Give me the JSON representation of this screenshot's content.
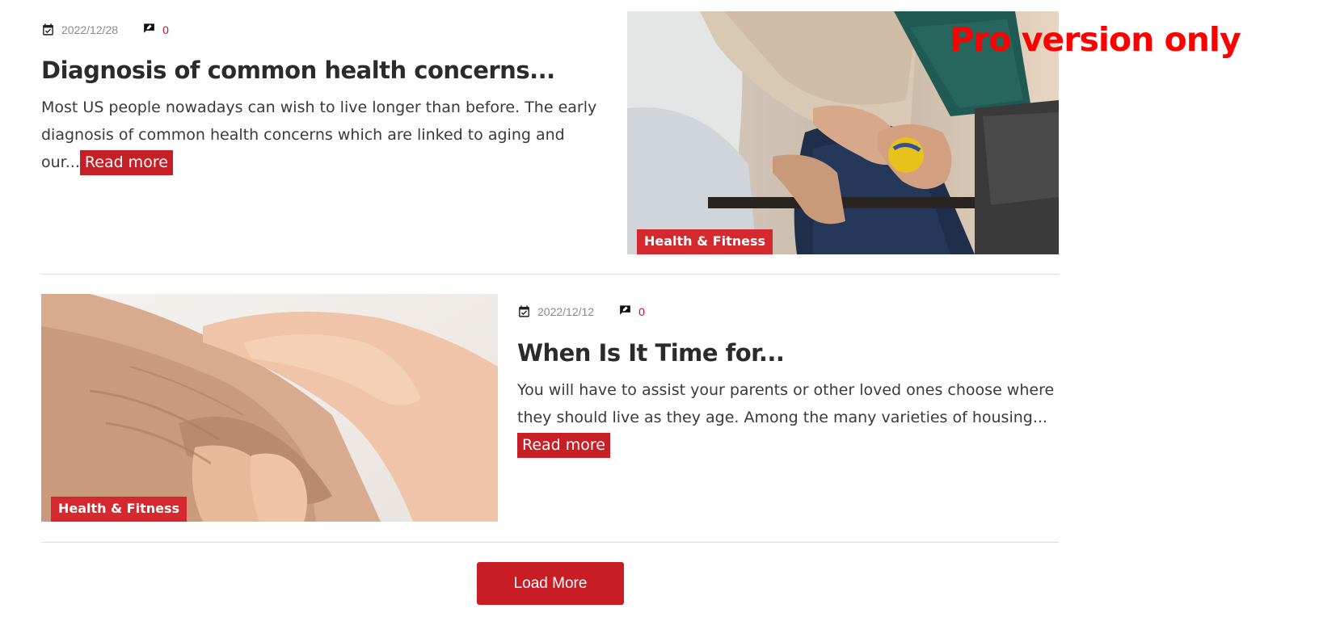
{
  "posts": [
    {
      "date": "2022/12/28",
      "comments": "0",
      "title": "Diagnosis of common health concerns...",
      "excerpt": "Most US people nowadays can wish to live longer than before. The early diagnosis of common health concerns which are linked to aging and our...",
      "read_more": "Read more",
      "category": "Health & Fitness"
    },
    {
      "date": "2022/12/12",
      "comments": "0",
      "title": "When Is It Time for...",
      "excerpt": "You will have to assist your parents or other loved ones choose where they should live as they age. Among the many varieties of housing...",
      "read_more": "Read more",
      "category": "Health & Fitness"
    }
  ],
  "load_more": "Load More",
  "watermark": "Pro version only",
  "colors": {
    "accent": "#c62026",
    "comment_count": "#c8102e",
    "watermark": "#ff0000"
  }
}
